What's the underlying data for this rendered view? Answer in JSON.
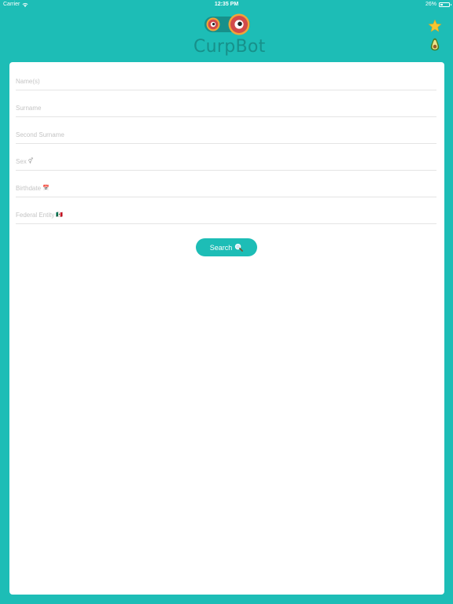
{
  "status_bar": {
    "carrier": "Carrier",
    "time": "12:35 PM",
    "battery_percent": "26%",
    "battery_level": 0.26
  },
  "header": {
    "app_name": "CurpBot",
    "logo_icon": "eyes-logo-icon",
    "favorites_icon": "star-icon",
    "avocado_icon": "avocado-icon"
  },
  "form": {
    "fields": [
      {
        "placeholder": "Name(s)",
        "emoji": ""
      },
      {
        "placeholder": "Surname",
        "emoji": ""
      },
      {
        "placeholder": "Second Surname",
        "emoji": ""
      },
      {
        "placeholder": "Sex",
        "emoji": "⚥"
      },
      {
        "placeholder": "Birthdate",
        "emoji": "📅"
      },
      {
        "placeholder": "Federal Entity",
        "emoji": "🇲🇽"
      }
    ],
    "search_label": "Search",
    "search_icon": "magnifier-icon"
  },
  "colors": {
    "teal": "#1dbdb6",
    "logo_text": "#17908a",
    "placeholder": "#c4c4c4",
    "divider": "#e4e4e4",
    "eye_red": "#d24a4a",
    "eye_ring": "#f0a33a",
    "star_yellow": "#f7c531"
  }
}
